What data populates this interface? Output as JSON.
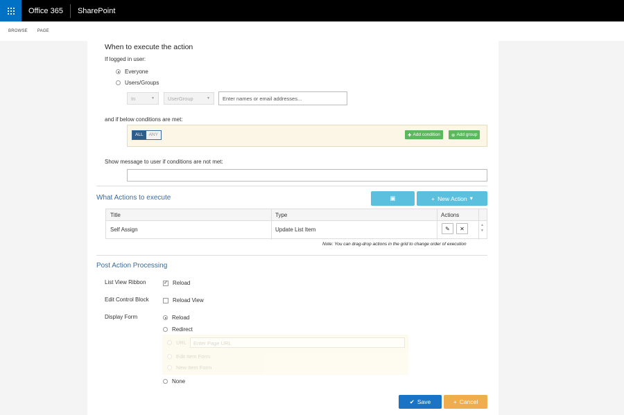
{
  "suitebar": {
    "app_name": "Office 365",
    "site_name": "SharePoint"
  },
  "ribbon": {
    "tabs": [
      "BROWSE",
      "PAGE"
    ]
  },
  "when": {
    "title": "When to execute the action",
    "logged_label": "If logged in user:",
    "options": [
      "Everyone",
      "Users/Groups"
    ],
    "selected": "Everyone",
    "op_select": "In",
    "type_select": "UserGroup",
    "names_placeholder": "Enter names or email addresses...",
    "conditions_label": "and if below conditions are met:",
    "all_label": "ALL",
    "any_label": "ANY",
    "add_condition": "Add condition",
    "add_group": "Add group",
    "message_label": "Show message to user if conditions are not met:",
    "message_value": ""
  },
  "actions": {
    "title": "What Actions to execute",
    "new_action": "New Action",
    "columns": [
      "Title",
      "Type",
      "Actions"
    ],
    "rows": [
      {
        "title": "Self Assign",
        "type": "Update List Item"
      }
    ],
    "note": "Note: You can drag-drop actions in the grid to change order of execution"
  },
  "post": {
    "title": "Post Action Processing",
    "list_view_label": "List View Ribbon",
    "list_view_option": "Reload",
    "list_view_checked": true,
    "ecb_label": "Edit Control Block",
    "ecb_option": "Reload View",
    "ecb_checked": false,
    "display_label": "Display Form",
    "display_options": [
      "Reload",
      "Redirect",
      "None"
    ],
    "display_selected": "Reload",
    "redirect": {
      "url_label": "URL",
      "url_placeholder": "Enter Page URL",
      "edit_item": "Edit Item Form",
      "new_item": "New Item Form"
    }
  },
  "footer": {
    "save": "Save",
    "cancel": "Cancel"
  },
  "colors": {
    "suite_accent": "#0072c6",
    "section_title": "#3a6a9c",
    "teal": "#5bc0de",
    "green": "#5cb85c",
    "save": "#1a73c4",
    "cancel": "#f0ad4e"
  }
}
